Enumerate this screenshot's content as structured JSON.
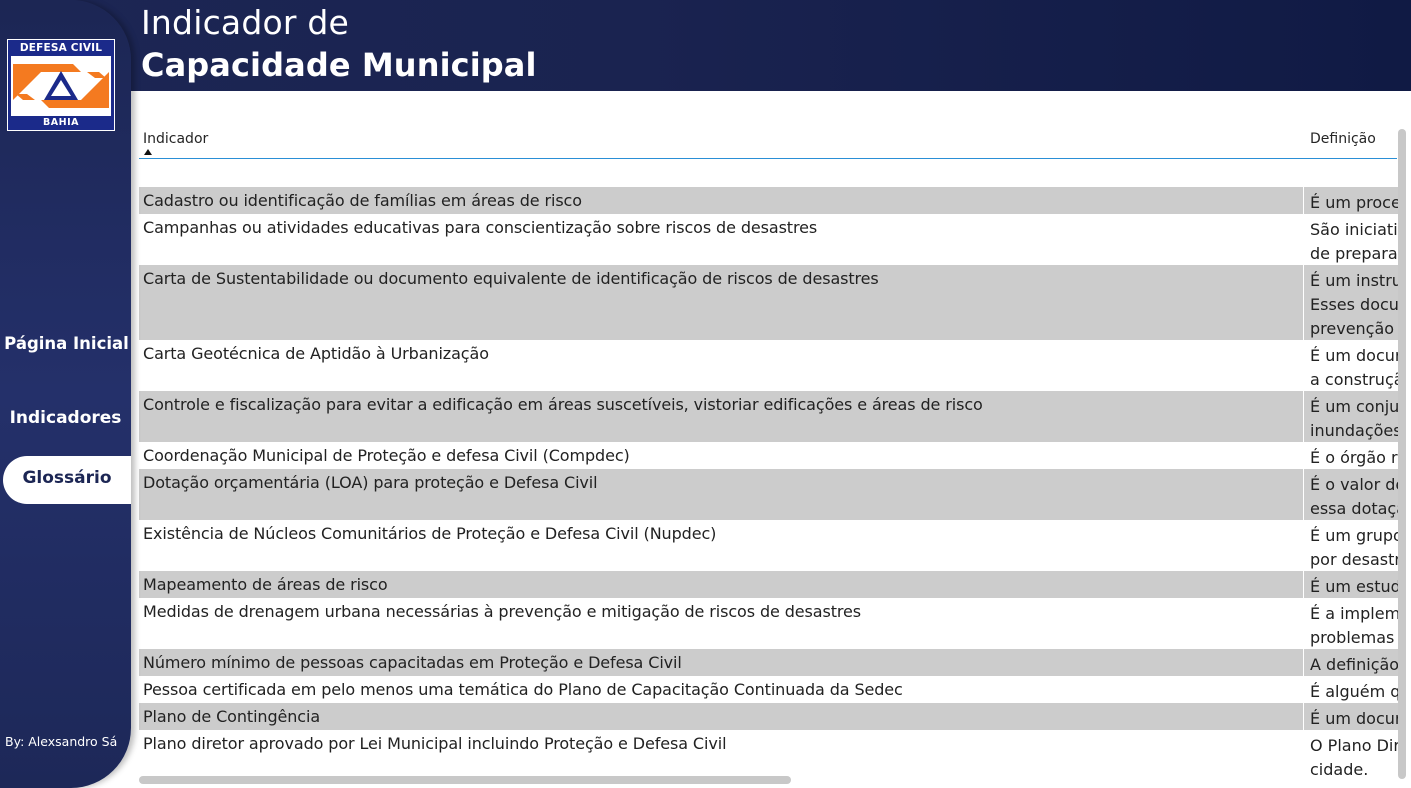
{
  "header": {
    "title_line1": "Indicador de",
    "title_line2": "Capacidade Municipal"
  },
  "logo": {
    "top_text": "DEFESA CIVIL",
    "bottom_text": "BAHIA",
    "colors": {
      "background": "#1b2a8a",
      "mark": "#f47a20"
    }
  },
  "sidebar": {
    "items": [
      {
        "label": "Página Inicial"
      },
      {
        "label": "Indicadores"
      },
      {
        "label": "Glossário",
        "active": true
      }
    ],
    "byline": "By: Alexsandro Sá"
  },
  "table": {
    "columns": {
      "indicator": "Indicador",
      "definition": "Definição"
    },
    "sort": "ascending",
    "rows": [
      {
        "indicator": "Cadastro ou identificação de famílias em áreas de risco",
        "definition": [
          "É um proce"
        ]
      },
      {
        "indicator": "Campanhas ou atividades educativas para conscientização sobre riscos de desastres",
        "definition": [
          "São iniciativ",
          "de preparac"
        ]
      },
      {
        "indicator": "Carta de Sustentabilidade ou documento equivalente de identificação de riscos de desastres",
        "definition": [
          "É um instru",
          "Esses docur",
          "prevenção"
        ]
      },
      {
        "indicator": "Carta Geotécnica de Aptidão à Urbanização",
        "definition": [
          "É um docur",
          "a construçã"
        ]
      },
      {
        "indicator": "Controle e fiscalização para evitar a edificação em áreas suscetíveis, vistoriar edificações e áreas de risco",
        "definition": [
          "É um conju",
          "inundações"
        ]
      },
      {
        "indicator": "Coordenação Municipal de Proteção e defesa Civil (Compdec)",
        "definition": [
          "É o órgão r"
        ]
      },
      {
        "indicator": "Dotação orçamentária (LOA) para proteção e Defesa Civil",
        "definition": [
          "É o valor de",
          "essa dotaçã"
        ]
      },
      {
        "indicator": "Existência de Núcleos Comunitários de Proteção e Defesa Civil (Nupdec)",
        "definition": [
          "É um grupo",
          "por desastr"
        ]
      },
      {
        "indicator": "Mapeamento de áreas de risco",
        "definition": [
          "É um estud"
        ]
      },
      {
        "indicator": "Medidas de drenagem urbana necessárias à prevenção e mitigação de riscos de desastres",
        "definition": [
          "É a implem",
          "problemas"
        ]
      },
      {
        "indicator": "Número mínimo de pessoas capacitadas em Proteção e Defesa Civil",
        "definition": [
          "A definição"
        ]
      },
      {
        "indicator": "Pessoa certificada em pelo menos uma temática do Plano de Capacitação Continuada da Sedec",
        "definition": [
          "É alguém q"
        ]
      },
      {
        "indicator": "Plano de Contingência",
        "definition": [
          "É um docur"
        ]
      },
      {
        "indicator": "Plano diretor aprovado por Lei Municipal incluindo Proteção e Defesa Civil",
        "definition": [
          "O Plano Dir",
          "cidade."
        ]
      }
    ]
  },
  "colors": {
    "header_bg": "#1c2654",
    "row_shade": "#cccccc",
    "header_underline": "#2a8fd6",
    "active_nav_bg": "#ffffff"
  }
}
